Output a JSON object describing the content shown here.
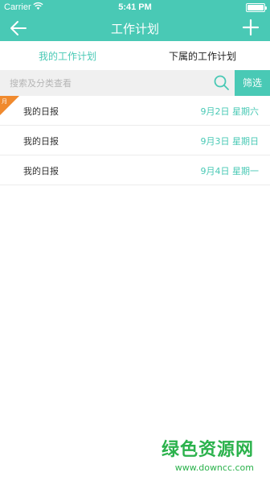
{
  "status_bar": {
    "carrier": "Carrier",
    "time": "5:41 PM"
  },
  "nav": {
    "title": "工作计划"
  },
  "tabs": [
    {
      "label": "我的工作计划",
      "active": true
    },
    {
      "label": "下属的工作计划",
      "active": false
    }
  ],
  "search": {
    "placeholder": "搜索及分类查看",
    "filter_label": "筛选"
  },
  "list": [
    {
      "label": "我的日报",
      "date": "9月2日 星期六",
      "badge": "月"
    },
    {
      "label": "我的日报",
      "date": "9月3日 星期日"
    },
    {
      "label": "我的日报",
      "date": "9月4日 星期一"
    }
  ],
  "watermark": {
    "main": "绿色资源网",
    "url": "www.downcc.com"
  },
  "colors": {
    "accent": "#49c9b5",
    "badge": "#f08a2e",
    "watermark": "#2bb24c"
  }
}
